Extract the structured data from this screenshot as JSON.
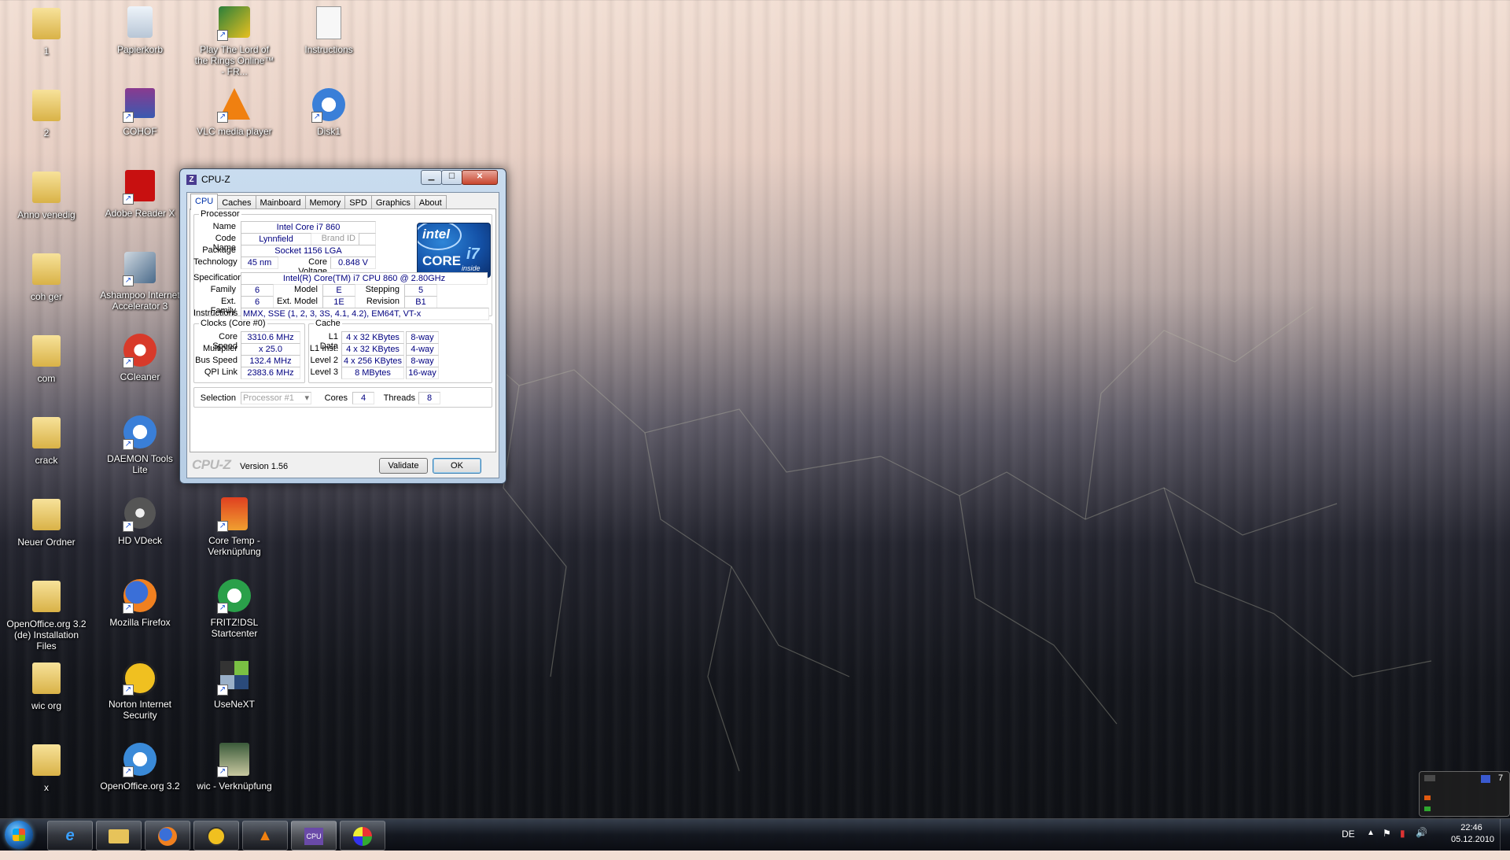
{
  "desktop": {
    "icons": [
      {
        "label": "1",
        "icon": "folder-icon"
      },
      {
        "label": "Papierkorb",
        "icon": "recycle-bin-icon"
      },
      {
        "label": "Play The Lord of the Rings Online™ - FR...",
        "icon": "lotro-icon"
      },
      {
        "label": "Instructions",
        "icon": "document-icon"
      },
      {
        "label": "2",
        "icon": "folder-icon"
      },
      {
        "label": "COHOF",
        "icon": "winrar-icon"
      },
      {
        "label": "VLC media player",
        "icon": "vlc-icon"
      },
      {
        "label": "Disk1",
        "icon": "daemon-tools-icon"
      },
      {
        "label": "Anno venedig",
        "icon": "folder-icon"
      },
      {
        "label": "Adobe Reader X",
        "icon": "adobe-reader-icon"
      },
      {
        "label": "coh ger",
        "icon": "folder-icon"
      },
      {
        "label": "Ashampoo Internet Accelerator 3",
        "icon": "ashampoo-icon"
      },
      {
        "label": "com",
        "icon": "folder-icon"
      },
      {
        "label": "CCleaner",
        "icon": "ccleaner-icon"
      },
      {
        "label": "crack",
        "icon": "folder-icon"
      },
      {
        "label": "DAEMON Tools Lite",
        "icon": "daemon-tools-icon"
      },
      {
        "label": "Neuer Ordner",
        "icon": "folder-icon"
      },
      {
        "label": "HD VDeck",
        "icon": "hdvdeck-icon"
      },
      {
        "label": "Core Temp - Verknüpfung",
        "icon": "core-temp-icon"
      },
      {
        "label": "OpenOffice.org 3.2 (de) Installation Files",
        "icon": "folder-icon"
      },
      {
        "label": "Mozilla Firefox",
        "icon": "firefox-icon"
      },
      {
        "label": "FRITZ!DSL Startcenter",
        "icon": "fritz-icon"
      },
      {
        "label": "wic org",
        "icon": "folder-icon"
      },
      {
        "label": "Norton Internet Security",
        "icon": "norton-icon"
      },
      {
        "label": "UseNeXT",
        "icon": "usenext-icon"
      },
      {
        "label": "x",
        "icon": "folder-icon"
      },
      {
        "label": "OpenOffice.org 3.2",
        "icon": "openoffice-icon"
      },
      {
        "label": "wic - Verknüpfung",
        "icon": "wic-icon"
      }
    ]
  },
  "window": {
    "title": "CPU-Z",
    "tabs": [
      "CPU",
      "Caches",
      "Mainboard",
      "Memory",
      "SPD",
      "Graphics",
      "About"
    ],
    "active_tab": "CPU",
    "processor": {
      "legend": "Processor",
      "name_label": "Name",
      "name": "Intel Core i7 860",
      "codename_label": "Code Name",
      "codename": "Lynnfield",
      "brandid_label": "Brand ID",
      "brandid": "",
      "package_label": "Package",
      "package": "Socket 1156 LGA",
      "technology_label": "Technology",
      "technology": "45 nm",
      "voltage_label": "Core Voltage",
      "voltage": "0.848 V",
      "spec_label": "Specification",
      "spec": "Intel(R) Core(TM) i7 CPU         860  @ 2.80GHz",
      "family_label": "Family",
      "family": "6",
      "model_label": "Model",
      "model": "E",
      "stepping_label": "Stepping",
      "stepping": "5",
      "extfamily_label": "Ext. Family",
      "extfamily": "6",
      "extmodel_label": "Ext. Model",
      "extmodel": "1E",
      "revision_label": "Revision",
      "revision": "B1",
      "instructions_label": "Instructions",
      "instructions": "MMX, SSE (1, 2, 3, 3S, 4.1, 4.2), EM64T, VT-x",
      "logo": {
        "brand": "intel",
        "line": "CORE",
        "model": "i7",
        "tag": "inside"
      }
    },
    "clocks": {
      "legend": "Clocks (Core #0)",
      "core_speed_label": "Core Speed",
      "core_speed": "3310.6 MHz",
      "multiplier_label": "Multiplier",
      "multiplier": "x 25.0",
      "bus_speed_label": "Bus Speed",
      "bus_speed": "132.4 MHz",
      "qpi_label": "QPI Link",
      "qpi": "2383.6 MHz"
    },
    "cache": {
      "legend": "Cache",
      "rows": [
        {
          "label": "L1 Data",
          "size": "4 x 32 KBytes",
          "way": "8-way"
        },
        {
          "label": "L1 Inst.",
          "size": "4 x 32 KBytes",
          "way": "4-way"
        },
        {
          "label": "Level 2",
          "size": "4 x 256 KBytes",
          "way": "8-way"
        },
        {
          "label": "Level 3",
          "size": "8 MBytes",
          "way": "16-way"
        }
      ]
    },
    "selection": {
      "label": "Selection",
      "value": "Processor #1",
      "cores_label": "Cores",
      "cores": "4",
      "threads_label": "Threads",
      "threads": "8"
    },
    "footer": {
      "logo": "CPU-Z",
      "version": "Version 1.56",
      "validate": "Validate",
      "ok": "OK"
    }
  },
  "taskbar": {
    "language": "DE",
    "time": "22:46",
    "date": "05.12.2010",
    "pinned": [
      "internet-explorer-icon",
      "explorer-icon",
      "firefox-icon",
      "norton-icon",
      "vlc-icon",
      "cpuz-icon",
      "paint-icon"
    ]
  },
  "gadget": {
    "value": "7"
  },
  "colors": {
    "value_text": "#000080",
    "accent": "#0033aa"
  }
}
